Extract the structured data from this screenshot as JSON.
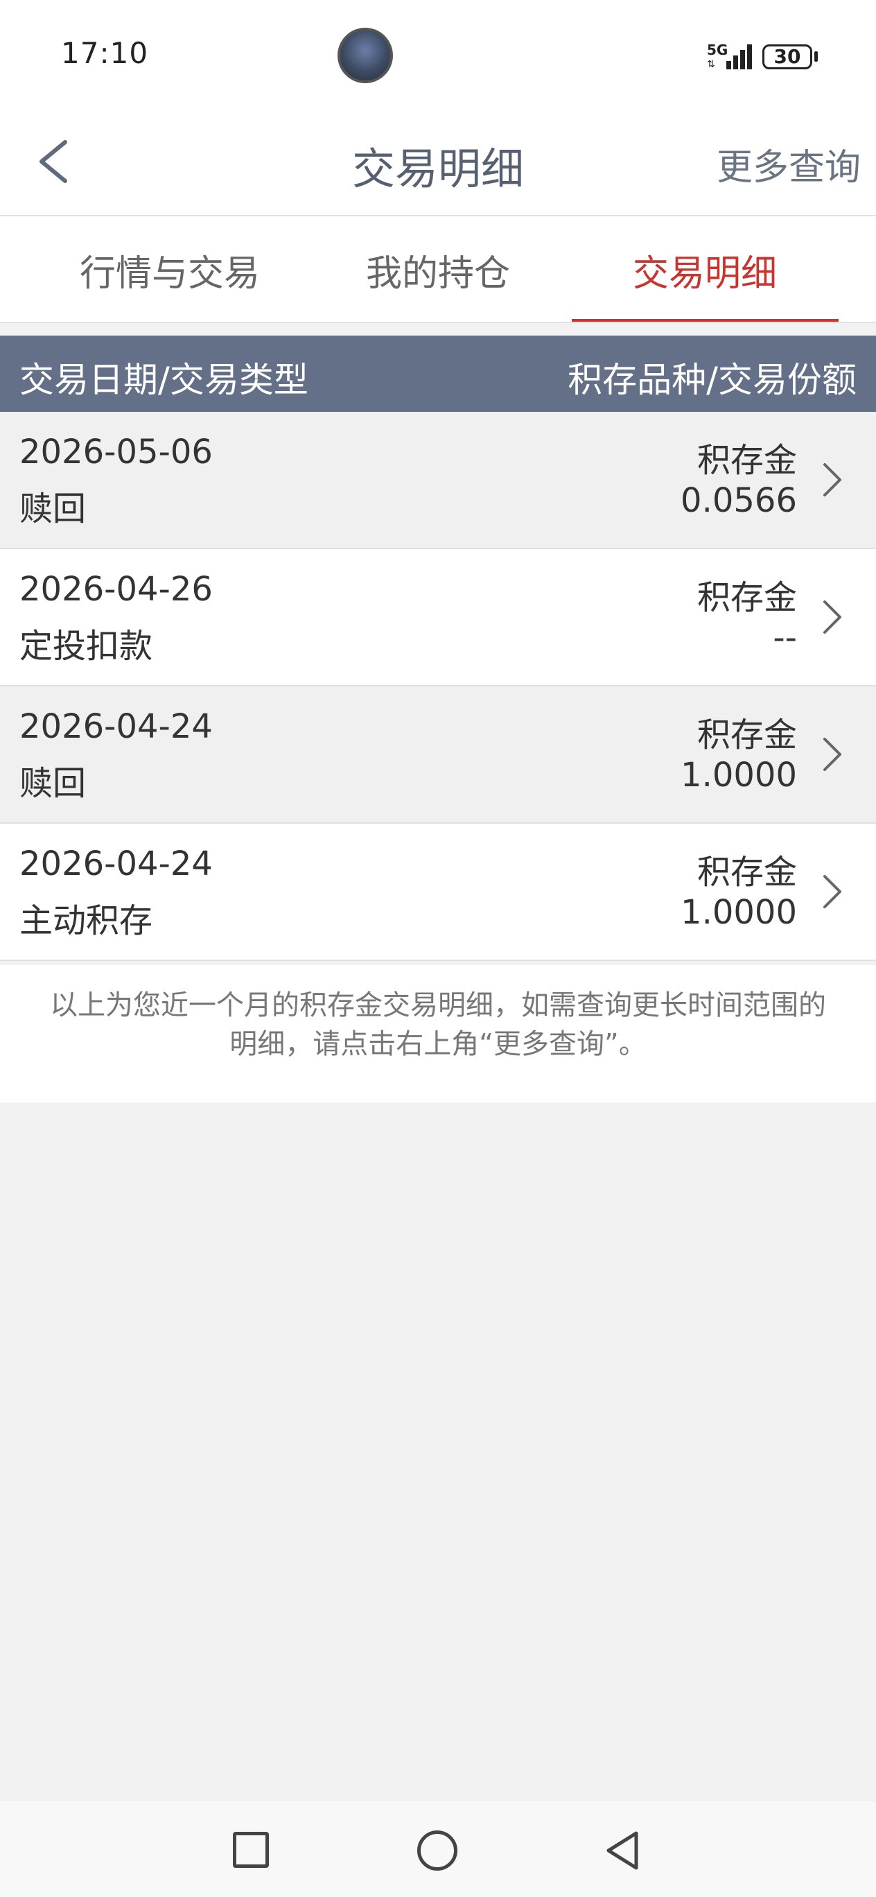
{
  "status_bar": {
    "time": "17:10",
    "network": "5G",
    "battery": "30"
  },
  "header": {
    "title": "交易明细",
    "more_query": "更多查询"
  },
  "tabs": [
    {
      "label": "行情与交易",
      "active": false
    },
    {
      "label": "我的持仓",
      "active": false
    },
    {
      "label": "交易明细",
      "active": true
    }
  ],
  "table": {
    "header_left": "交易日期/交易类型",
    "header_right": "积存品种/交易份额",
    "rows": [
      {
        "date": "2026-05-06",
        "type": "赎回",
        "product": "积存金",
        "amount": "0.0566"
      },
      {
        "date": "2026-04-26",
        "type": "定投扣款",
        "product": "积存金",
        "amount": "--"
      },
      {
        "date": "2026-04-24",
        "type": "赎回",
        "product": "积存金",
        "amount": "1.0000"
      },
      {
        "date": "2026-04-24",
        "type": "主动积存",
        "product": "积存金",
        "amount": "1.0000"
      }
    ]
  },
  "note": "以上为您近一个月的积存金交易明细，如需查询更长时间范围的明细，请点击右上角“更多查询”。",
  "colors": {
    "accent": "#c8352f",
    "table_header": "#637088",
    "title": "#556070"
  }
}
